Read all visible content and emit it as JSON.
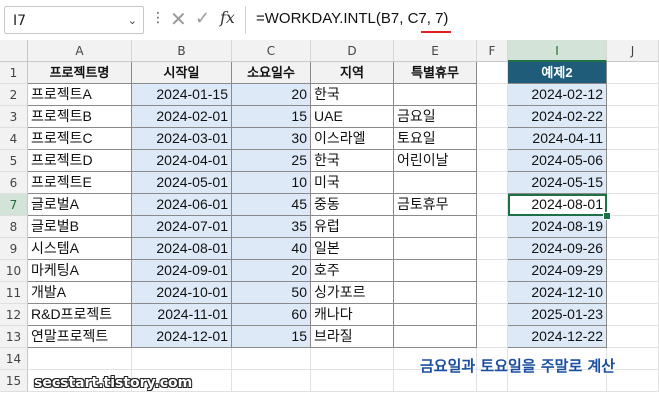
{
  "formula_bar": {
    "cell_ref": "I7",
    "fx_label": "fx",
    "formula": "=WORKDAY.INTL(B7, C7, 7)"
  },
  "columns": [
    "A",
    "B",
    "C",
    "D",
    "E",
    "F",
    "I",
    "J"
  ],
  "rows": [
    "1",
    "2",
    "3",
    "4",
    "5",
    "6",
    "7",
    "8",
    "9",
    "10",
    "11",
    "12",
    "13",
    "14",
    "15"
  ],
  "table": {
    "headers": [
      "프로젝트명",
      "시작일",
      "소요일수",
      "지역",
      "특별휴무"
    ],
    "rows": [
      [
        "프로젝트A",
        "2024-01-15",
        "20",
        "한국",
        ""
      ],
      [
        "프로젝트B",
        "2024-02-01",
        "15",
        "UAE",
        "금요일"
      ],
      [
        "프로젝트C",
        "2024-03-01",
        "30",
        "이스라엘",
        "토요일"
      ],
      [
        "프로젝트D",
        "2024-04-01",
        "25",
        "한국",
        "어린이날"
      ],
      [
        "프로젝트E",
        "2024-05-01",
        "10",
        "미국",
        ""
      ],
      [
        "글로벌A",
        "2024-06-01",
        "45",
        "중동",
        "금토휴무"
      ],
      [
        "글로벌B",
        "2024-07-01",
        "35",
        "유럽",
        ""
      ],
      [
        "시스템A",
        "2024-08-01",
        "40",
        "일본",
        ""
      ],
      [
        "마케팅A",
        "2024-09-01",
        "20",
        "호주",
        ""
      ],
      [
        "개발A",
        "2024-10-01",
        "50",
        "싱가포르",
        ""
      ],
      [
        "R&D프로젝트",
        "2024-11-01",
        "60",
        "캐나다",
        ""
      ],
      [
        "연말프로젝트",
        "2024-12-01",
        "15",
        "브라질",
        ""
      ]
    ]
  },
  "result": {
    "header": "예제2",
    "values": [
      "2024-02-12",
      "2024-02-22",
      "2024-04-11",
      "2024-05-06",
      "2024-05-15",
      "2024-08-01",
      "2024-08-19",
      "2024-09-26",
      "2024-09-29",
      "2024-12-10",
      "2025-01-23",
      "2024-12-22"
    ]
  },
  "annotation": "금요일과 토요일을 주말로 계산",
  "watermark": "secstart.tistory.com",
  "colors": {
    "accent": "#1e7145",
    "header_fill": "#1f5c7a",
    "highlight": "#dde9f6",
    "note": "#1c4ea0"
  }
}
